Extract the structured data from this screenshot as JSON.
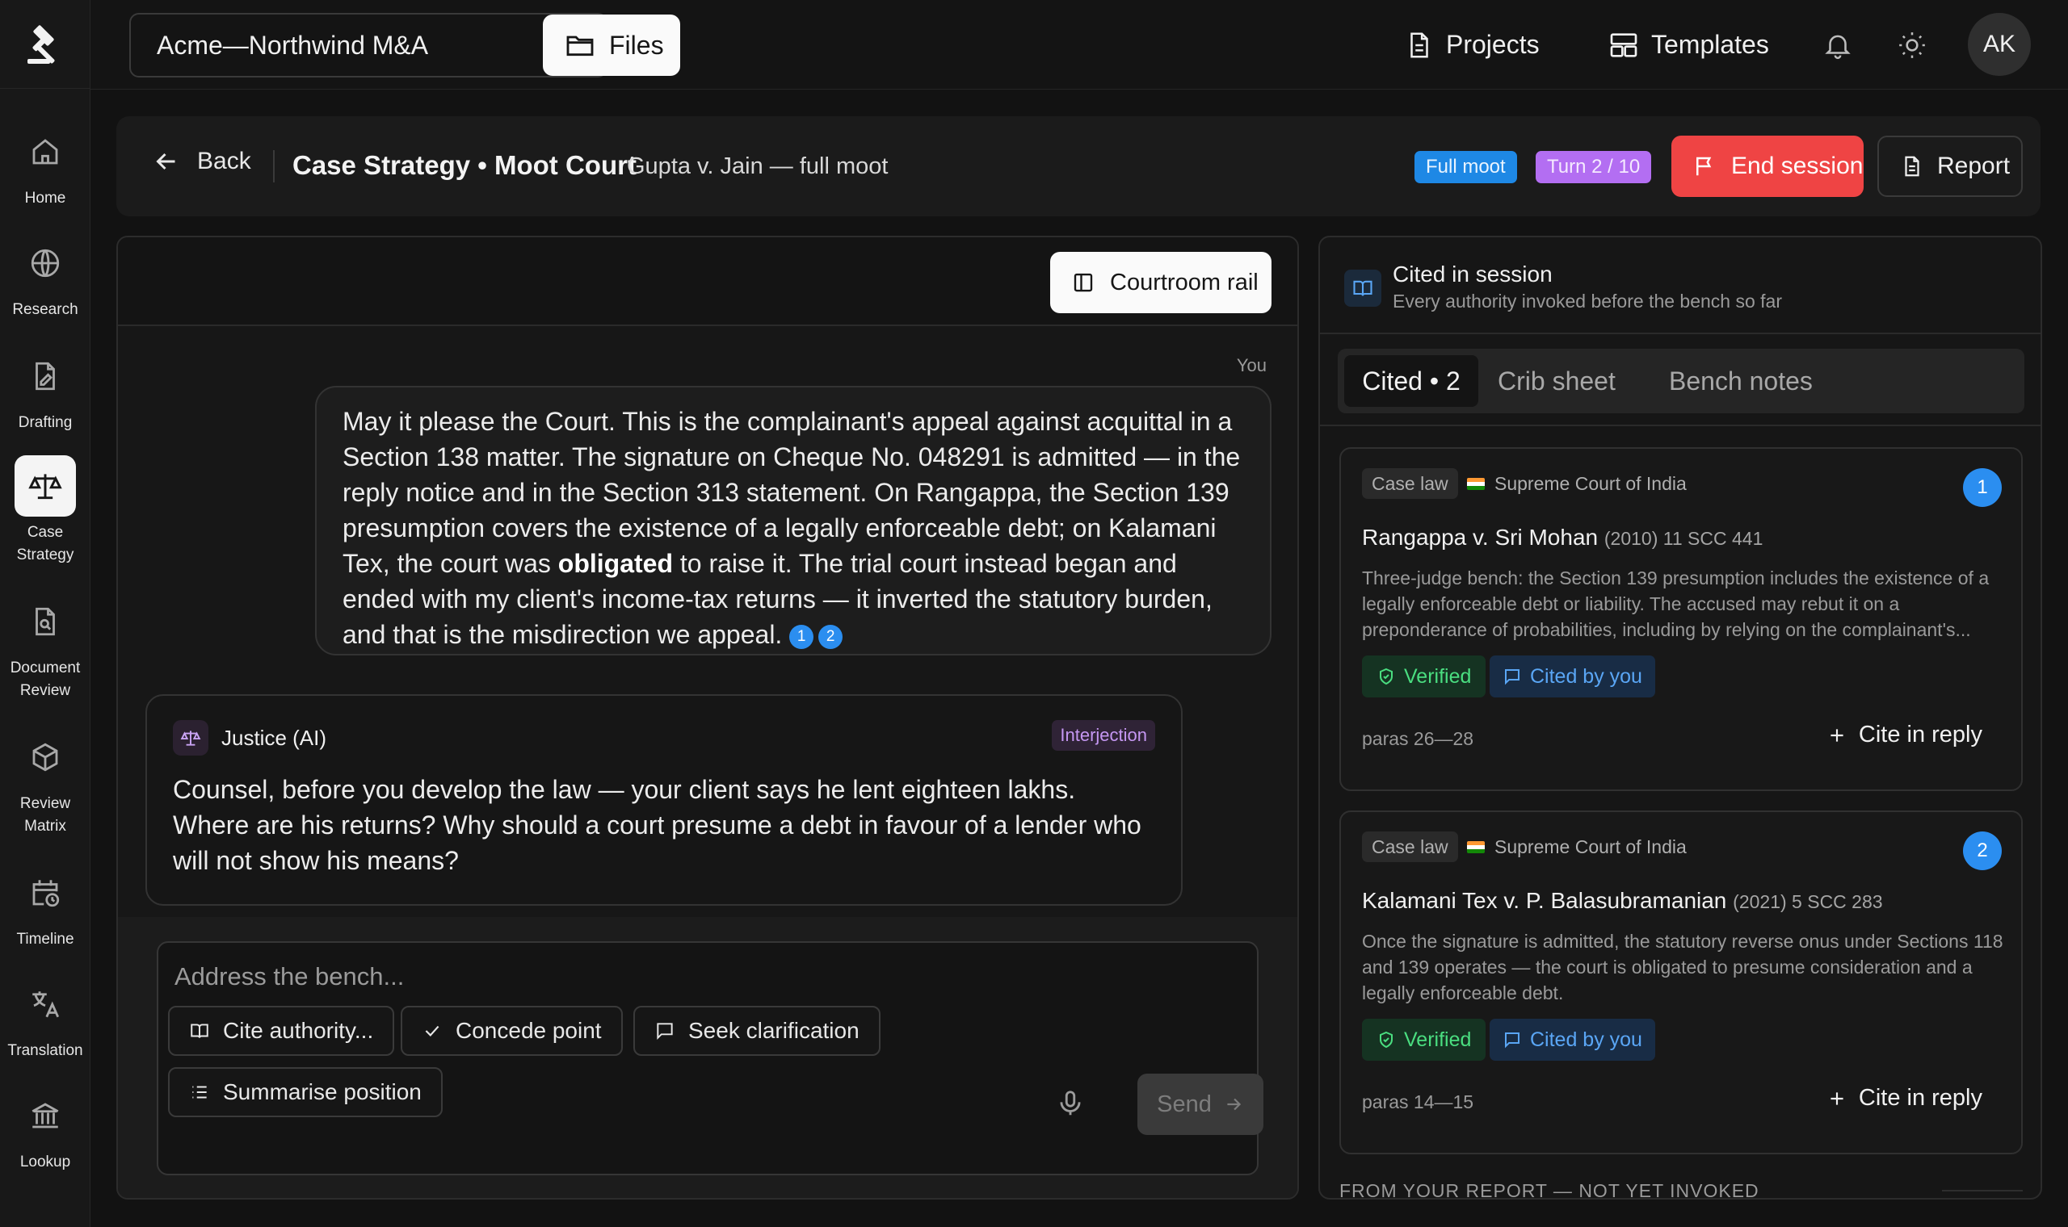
{
  "sidebar": {
    "items": [
      {
        "label": "Home",
        "icon": "home-icon"
      },
      {
        "label": "Research",
        "icon": "globe-icon"
      },
      {
        "label": "Drafting",
        "icon": "document-edit-icon"
      },
      {
        "label": "Case\nStrategy",
        "icon": "scales-icon",
        "active": true
      },
      {
        "label": "Document\nReview",
        "icon": "document-search-icon"
      },
      {
        "label": "Review\nMatrix",
        "icon": "cube-icon"
      },
      {
        "label": "Timeline",
        "icon": "calendar-clock-icon"
      },
      {
        "label": "Translation",
        "icon": "translate-icon"
      },
      {
        "label": "Lookup",
        "icon": "bank-icon"
      }
    ]
  },
  "topbar": {
    "workspace": "Acme—Northwind M&A",
    "files_label": "Files",
    "projects_label": "Projects",
    "templates_label": "Templates",
    "avatar_initials": "AK"
  },
  "header": {
    "back_label": "Back",
    "title": "Case Strategy • Moot Court",
    "subtitle": "Gupta v. Jain — full moot",
    "mode_badge": "Full moot",
    "turn_badge": "Turn 2 / 10",
    "end_label": "End session",
    "report_label": "Report"
  },
  "chat": {
    "rail_label": "Courtroom rail",
    "you_label": "You",
    "user_message": {
      "before": "May it please the Court. This is the complainant's appeal against acquittal in a Section 138 matter. The signature on Cheque No. 048291 is admitted — in the reply notice and in the Section 313 statement. On Rangappa, the Section 139 presumption covers the existence of a legally enforceable debt; on Kalamani Tex, the court was ",
      "bold": "obligated",
      "after": " to raise it. The trial court instead began and ended with my client's income-tax returns — it inverted the statutory burden, and that is the misdirection we appeal. ",
      "citations": [
        "1",
        "2"
      ]
    },
    "ai_message": {
      "speaker": "Justice (AI)",
      "tag": "Interjection",
      "text": "Counsel, before you develop the law — your client says he lent eighteen lakhs. Where are his returns? Why should a court presume a debt in favour of a lender who will not show his means?"
    },
    "composer": {
      "placeholder": "Address the bench...",
      "chips": [
        "Cite authority...",
        "Concede point",
        "Seek clarification",
        "Summarise position"
      ],
      "send_label": "Send"
    }
  },
  "cited_panel": {
    "title": "Cited in session",
    "subtitle": "Every authority invoked before the bench so far",
    "tabs": [
      "Cited • 2",
      "Crib sheet",
      "Bench notes"
    ],
    "cards": [
      {
        "tag": "Case law",
        "court": "Supreme Court of India",
        "number": "1",
        "case_name": "Rangappa v. Sri Mohan",
        "citation": "(2010) 11 SCC 441",
        "summary": "Three-judge bench: the Section 139 presumption includes the existence of a legally enforceable debt or liability. The accused may rebut it on a preponderance of probabilities, including by relying on the complainant's...",
        "verified_label": "Verified",
        "cited_label": "Cited by you",
        "paras": "paras 26—28",
        "action": "Cite in reply"
      },
      {
        "tag": "Case law",
        "court": "Supreme Court of India",
        "number": "2",
        "case_name": "Kalamani Tex v. P. Balasubramanian",
        "citation": "(2021) 5 SCC 283",
        "summary": "Once the signature is admitted, the statutory reverse onus under Sections 118 and 139 operates — the court is obligated to presume consideration and a legally enforceable debt.",
        "verified_label": "Verified",
        "cited_label": "Cited by you",
        "paras": "paras 14—15",
        "action": "Cite in reply"
      }
    ],
    "footer": "FROM YOUR REPORT — NOT YET INVOKED"
  },
  "colors": {
    "accent_red": "#ef4444",
    "accent_blue": "#2b8ef0",
    "accent_purple": "#b36ef2",
    "verified_green": "#4ade80"
  }
}
